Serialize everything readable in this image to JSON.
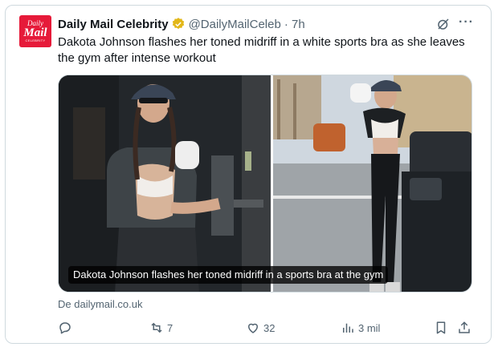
{
  "account": {
    "avatar_lines": [
      "Daily",
      "Mail",
      "CELEBRITY"
    ],
    "display_name": "Daily Mail Celebrity",
    "handle": "@DailyMailCeleb",
    "time": "· 7h"
  },
  "tweet": {
    "text": "Dakota Johnson flashes her toned midriff in a white sports bra as she leaves the gym after intense workout"
  },
  "media": {
    "caption": "Dakota Johnson flashes her toned midriff in a sports bra at the gym"
  },
  "source": {
    "text": "De dailymail.co.uk"
  },
  "actions": {
    "replies": "",
    "retweets": "7",
    "likes": "32",
    "views": "3 mil"
  },
  "colors": {
    "brand": "#e61a39",
    "verified": "#e2b719",
    "muted": "#536471"
  }
}
